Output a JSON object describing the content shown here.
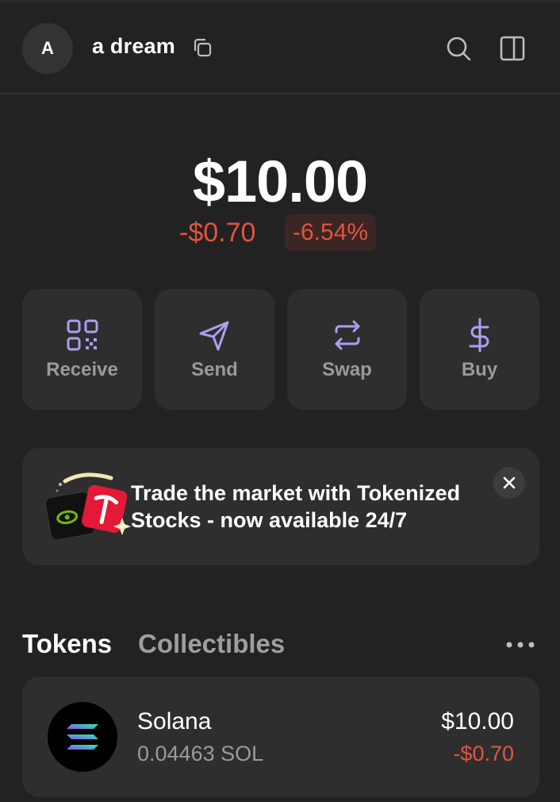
{
  "header": {
    "avatar_letter": "A",
    "account_name": "a dream",
    "icons": [
      "copy-icon",
      "search-icon",
      "sidebar-panel-icon"
    ]
  },
  "balance": {
    "total": "$10.00",
    "change_value": "-$0.70",
    "change_percent": "-6.54%"
  },
  "actions": [
    {
      "label": "Receive",
      "icon": "qr-code-icon"
    },
    {
      "label": "Send",
      "icon": "send-icon"
    },
    {
      "label": "Swap",
      "icon": "swap-icon"
    },
    {
      "label": "Buy",
      "icon": "dollar-icon"
    }
  ],
  "banner": {
    "text": "Trade the market with Tokenized Stocks - now available 24/7",
    "icon": "tokenized-stocks-icon"
  },
  "tabs": [
    {
      "label": "Tokens",
      "active": true
    },
    {
      "label": "Collectibles",
      "active": false
    }
  ],
  "tokens": [
    {
      "name": "Solana",
      "amount": "0.04463 SOL",
      "value": "$10.00",
      "change": "-$0.70",
      "icon": "solana-logo"
    }
  ],
  "colors": {
    "background": "#222222",
    "card": "#2e2e2e",
    "accent": "#ab9ff2",
    "negative": "#e5533d",
    "muted_text": "#9a9a9a"
  }
}
